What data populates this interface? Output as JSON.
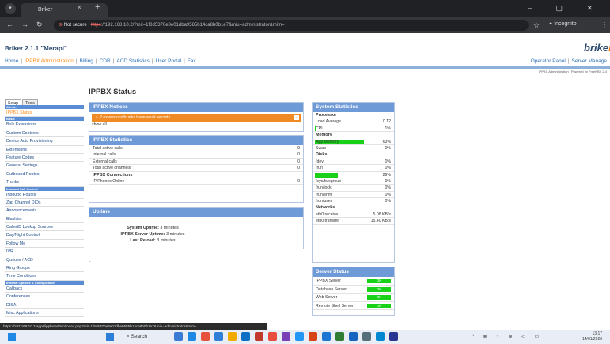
{
  "browser": {
    "tab_title": "Briker",
    "tab_close": "×",
    "new_tab": "+",
    "not_secure": "Not secure",
    "https": "https",
    "url": "://192.168.10.2/?mit=1f8d5370e3e01dba9585b14ca8b0b1e7&miu=administrator&mim=",
    "incognito": "Incognito",
    "window_controls": "–  ▢  ✕"
  },
  "header": {
    "app_title": "Briker 2.1.1 \"Merapi\"",
    "logo": "brike",
    "logo_tail": "r",
    "nav": [
      "Home",
      "IPPBX Administration",
      "Billing",
      "CDR",
      "ACD Statistics",
      "User Portal",
      "Fax"
    ],
    "nav_active": 1,
    "right_nav": [
      "Operator Panel",
      "Server Manage"
    ],
    "powered": "IPPBX Administration | Powered by FreePBX 2.4"
  },
  "sidebar": {
    "tabs": [
      "Setup",
      "Tools"
    ],
    "items": [
      {
        "type": "head",
        "label": "Admin"
      },
      {
        "type": "item",
        "label": "IPPBX Status",
        "active": true
      },
      {
        "type": "head",
        "label": "Basic"
      },
      {
        "type": "item",
        "label": "Bulk Extensions"
      },
      {
        "type": "item",
        "label": "Custom Contexts"
      },
      {
        "type": "item",
        "label": "Device Auto Provisioning"
      },
      {
        "type": "item",
        "label": "Extensions"
      },
      {
        "type": "item",
        "label": "Feature Codes"
      },
      {
        "type": "item",
        "label": "General Settings"
      },
      {
        "type": "item",
        "label": "Outbound Routes"
      },
      {
        "type": "item",
        "label": "Trunks"
      },
      {
        "type": "head",
        "label": "Inbound Call Control"
      },
      {
        "type": "item",
        "label": "Inbound Routes"
      },
      {
        "type": "item",
        "label": "Zap Channel DIDs"
      },
      {
        "type": "item",
        "label": "Announcements"
      },
      {
        "type": "item",
        "label": "Blacklist"
      },
      {
        "type": "item",
        "label": "CallerID Lookup Sources"
      },
      {
        "type": "item",
        "label": "Day/Night Control"
      },
      {
        "type": "item",
        "label": "Follow Me"
      },
      {
        "type": "item",
        "label": "IVR"
      },
      {
        "type": "item",
        "label": "Queues / ACD"
      },
      {
        "type": "item",
        "label": "Ring Groups"
      },
      {
        "type": "item",
        "label": "Time Conditions"
      },
      {
        "type": "head",
        "label": "Internal Options & Configuration"
      },
      {
        "type": "item",
        "label": "Callback"
      },
      {
        "type": "item",
        "label": "Conferences"
      },
      {
        "type": "item",
        "label": "DISA"
      },
      {
        "type": "item",
        "label": "Misc Applications"
      }
    ]
  },
  "main": {
    "page_title": "IPPBX Status",
    "notices": {
      "title": "IPPBX Notices",
      "alert": "2 extensions/trunks have weak secrets",
      "alert_close": "–",
      "show_all": "show all"
    },
    "stats": {
      "title": "IPPBX Statistics",
      "rows": [
        {
          "label": "Total active calls",
          "value": "0"
        },
        {
          "label": "Internal calls",
          "value": "0"
        },
        {
          "label": "External calls",
          "value": "0"
        },
        {
          "label": "Total active channels",
          "value": "0"
        }
      ],
      "connections_head": "IPPBX Connections",
      "connections": [
        {
          "label": "IP Phones Online",
          "value": "0"
        }
      ]
    },
    "uptime": {
      "title": "Uptime",
      "rows": [
        {
          "label": "System Uptime:",
          "value": "3 minutes"
        },
        {
          "label": "IPPBX Server Uptime:",
          "value": "3 minutes"
        },
        {
          "label": "Last Reload:",
          "value": "3 minutes"
        }
      ]
    },
    "dot": "."
  },
  "system": {
    "title": "System Statistics",
    "sections": [
      {
        "head": "Processor",
        "rows": [
          {
            "label": "Load Average",
            "value": "0.12",
            "level": 0
          },
          {
            "label": "CPU",
            "value": "1%",
            "level": 0.01
          }
        ]
      },
      {
        "head": "Memory",
        "rows": [
          {
            "label": "App Memory",
            "value": "63%",
            "level": 0.63
          },
          {
            "label": "Swap",
            "value": "0%",
            "level": 0
          }
        ]
      },
      {
        "head": "Disks",
        "rows": [
          {
            "label": "/dev",
            "value": "0%",
            "level": 0
          },
          {
            "label": "/run",
            "value": "0%",
            "level": 0
          },
          {
            "label": "/",
            "value": "29%",
            "level": 0.29
          },
          {
            "label": "/sys/fs/cgroup",
            "value": "0%",
            "level": 0
          },
          {
            "label": "/run/lock",
            "value": "0%",
            "level": 0
          },
          {
            "label": "/run/shm",
            "value": "0%",
            "level": 0
          },
          {
            "label": "/run/user",
            "value": "0%",
            "level": 0
          }
        ]
      },
      {
        "head": "Networks",
        "rows": [
          {
            "label": "eth0 receive",
            "value": "5.08 KB/s",
            "level": 0
          },
          {
            "label": "eth0 transmit",
            "value": "15.40 KB/s",
            "level": 0
          }
        ]
      }
    ],
    "bar_color": "#19d119"
  },
  "server_status": {
    "title": "Server Status",
    "rows": [
      {
        "label": "IPPBX Server",
        "status": "OK"
      },
      {
        "label": "Database Server",
        "status": "OK"
      },
      {
        "label": "Web Server",
        "status": "OK"
      },
      {
        "label": "Remote Shell Server",
        "status": "OK"
      }
    ]
  },
  "statusbar": {
    "url": "https://192.168.10.2/apps/ippbx/admin/index.php?mit=1f8d5370e3e01dba9585b14ca8b0b1e7&miu=administrator&mim="
  },
  "taskbar": {
    "search": "Search",
    "time": "13:17",
    "date": "14/01/2026",
    "tray": "^ ⊗ ◔ ⊕ ◁ ▭"
  }
}
